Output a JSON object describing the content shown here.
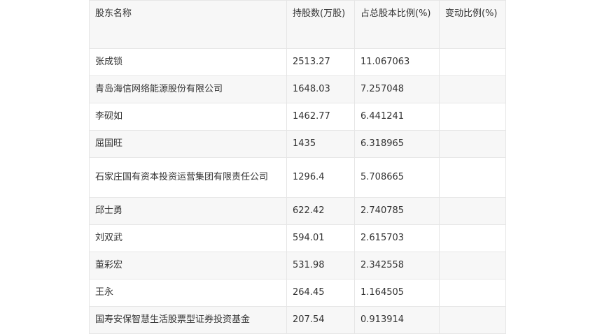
{
  "table": {
    "headers": [
      "股东名称",
      "持股数(万股)",
      "占总股本比例(%)",
      "变动比例(%)"
    ],
    "rows": [
      {
        "name": "张成锁",
        "shares": "2513.27",
        "ratio": "11.067063",
        "change": ""
      },
      {
        "name": "青岛海信网络能源股份有限公司",
        "shares": "1648.03",
        "ratio": "7.257048",
        "change": ""
      },
      {
        "name": "李砚如",
        "shares": "1462.77",
        "ratio": "6.441241",
        "change": ""
      },
      {
        "name": "屈国旺",
        "shares": "1435",
        "ratio": "6.318965",
        "change": ""
      },
      {
        "name": "石家庄国有资本投资运营集团有限责任公司",
        "shares": "1296.4",
        "ratio": "5.708665",
        "change": ""
      },
      {
        "name": "邱士勇",
        "shares": "622.42",
        "ratio": "2.740785",
        "change": ""
      },
      {
        "name": "刘双武",
        "shares": "594.01",
        "ratio": "2.615703",
        "change": ""
      },
      {
        "name": "董彩宏",
        "shares": "531.98",
        "ratio": "2.342558",
        "change": ""
      },
      {
        "name": "王永",
        "shares": "264.45",
        "ratio": "1.164505",
        "change": ""
      },
      {
        "name": "国寿安保智慧生活股票型证券投资基金",
        "shares": "207.54",
        "ratio": "0.913914",
        "change": ""
      }
    ]
  }
}
